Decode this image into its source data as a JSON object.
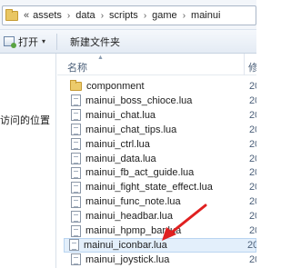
{
  "address": {
    "chevron": "«",
    "crumbs": [
      "assets",
      "data",
      "scripts",
      "game",
      "mainui"
    ],
    "separator": "›"
  },
  "toolbar": {
    "open_label": "打开",
    "dropdown_glyph": "▾",
    "new_folder_label": "新建文件夹"
  },
  "nav": {
    "partial_text": "访问的位置"
  },
  "columns": {
    "name": "名称",
    "sort_glyph": "▲",
    "modified": "修"
  },
  "files": [
    {
      "name": "componment",
      "type": "folder",
      "date": "20"
    },
    {
      "name": "mainui_boss_chioce.lua",
      "type": "lua",
      "date": "20"
    },
    {
      "name": "mainui_chat.lua",
      "type": "lua",
      "date": "20"
    },
    {
      "name": "mainui_chat_tips.lua",
      "type": "lua",
      "date": "20"
    },
    {
      "name": "mainui_ctrl.lua",
      "type": "lua",
      "date": "20"
    },
    {
      "name": "mainui_data.lua",
      "type": "lua",
      "date": "20"
    },
    {
      "name": "mainui_fb_act_guide.lua",
      "type": "lua",
      "date": "20"
    },
    {
      "name": "mainui_fight_state_effect.lua",
      "type": "lua",
      "date": "20"
    },
    {
      "name": "mainui_func_note.lua",
      "type": "lua",
      "date": "20"
    },
    {
      "name": "mainui_headbar.lua",
      "type": "lua",
      "date": "20"
    },
    {
      "name": "mainui_hpmp_bar.lua",
      "type": "lua",
      "date": "20"
    },
    {
      "name": "mainui_iconbar.lua",
      "type": "lua",
      "date": "20",
      "selected": true
    },
    {
      "name": "mainui_joystick.lua",
      "type": "lua",
      "date": "20"
    }
  ],
  "colors": {
    "annotation_arrow": "#e02020",
    "selection": "#e3effb"
  }
}
